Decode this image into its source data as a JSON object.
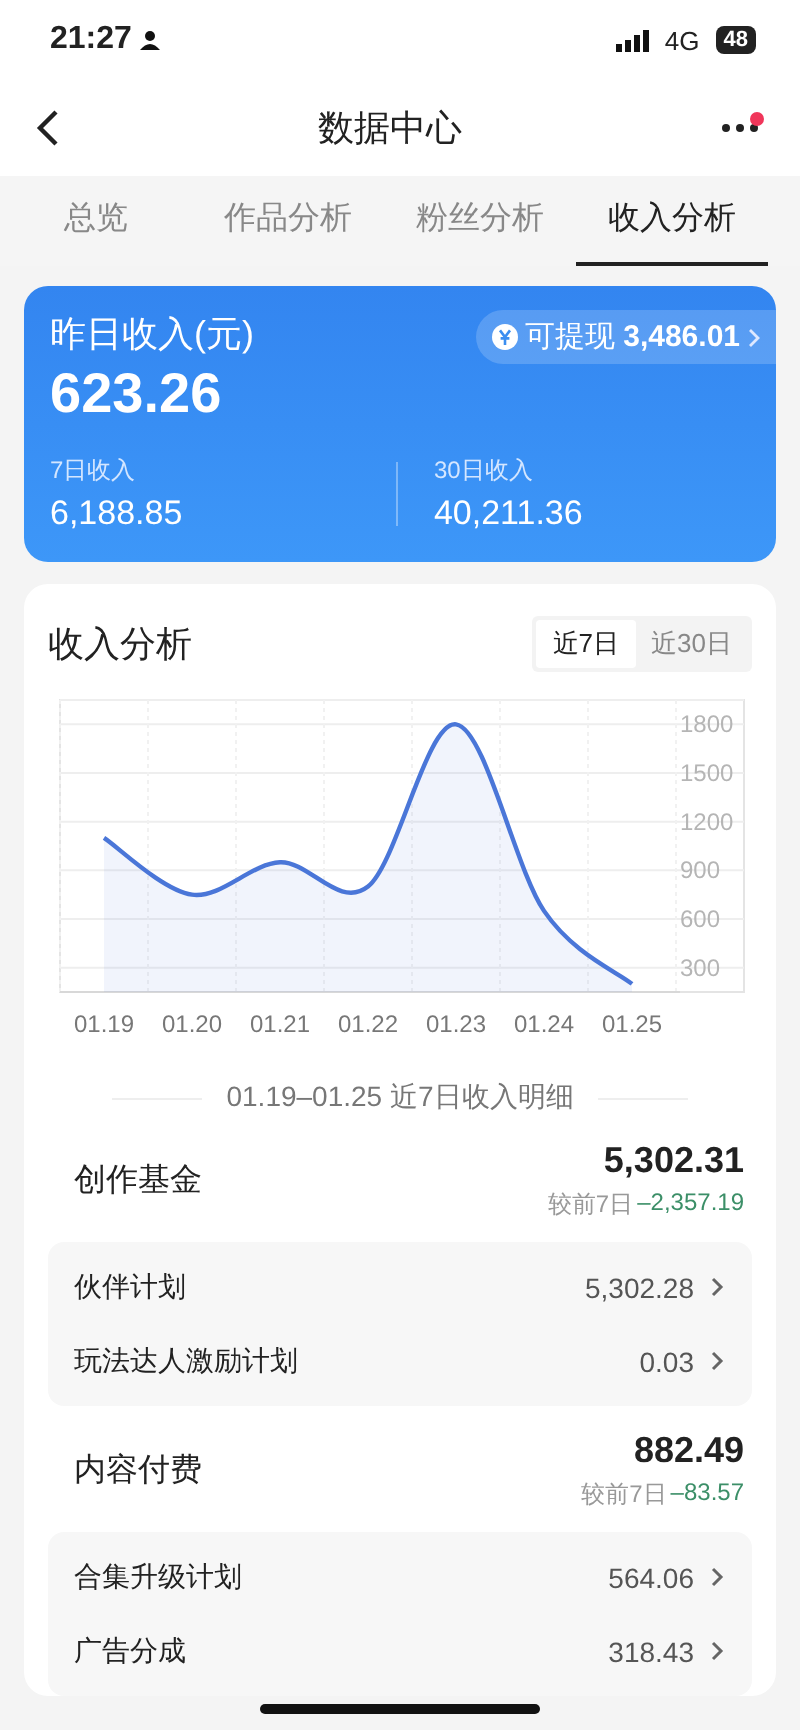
{
  "status_bar": {
    "time": "21:27",
    "network": "4G",
    "battery": "48"
  },
  "nav": {
    "title": "数据中心",
    "has_badge": true
  },
  "tabs": [
    {
      "label": "总览",
      "selected": false
    },
    {
      "label": "作品分析",
      "selected": false
    },
    {
      "label": "粉丝分析",
      "selected": false
    },
    {
      "label": "收入分析",
      "selected": true
    }
  ],
  "income_card": {
    "title": "昨日收入(元)",
    "amount": "623.26",
    "withdraw_label": "可提现",
    "withdraw_amount": "3,486.01",
    "stats": [
      {
        "label": "7日收入",
        "value": "6,188.85"
      },
      {
        "label": "30日收入",
        "value": "40,211.36"
      }
    ]
  },
  "analysis": {
    "title": "收入分析",
    "ranges": [
      {
        "label": "近7日",
        "selected": true
      },
      {
        "label": "近30日",
        "selected": false
      }
    ],
    "chart_data": {
      "type": "area",
      "grid": true,
      "categories": [
        "01.19",
        "01.20",
        "01.21",
        "01.22",
        "01.23",
        "01.24",
        "01.25"
      ],
      "series": [
        {
          "color": "#4a76d8",
          "values": [
            1100,
            750,
            950,
            800,
            1800,
            650,
            200
          ]
        }
      ],
      "ylim": [
        150,
        1950
      ],
      "yticks": [
        300,
        600,
        900,
        1200,
        1500,
        1800
      ]
    }
  },
  "detail_heading": "01.19–01.25 近7日收入明细",
  "groups": [
    {
      "title": "创作基金",
      "total": "5,302.31",
      "compare_label": "较前7日",
      "change": "–2,357.19",
      "items": [
        {
          "label": "伙伴计划",
          "value": "5,302.28"
        },
        {
          "label": "玩法达人激励计划",
          "value": "0.03"
        }
      ]
    },
    {
      "title": "内容付费",
      "total": "882.49",
      "compare_label": "较前7日",
      "change": "–83.57",
      "items": [
        {
          "label": "合集升级计划",
          "value": "564.06"
        },
        {
          "label": "广告分成",
          "value": "318.43"
        }
      ]
    }
  ]
}
